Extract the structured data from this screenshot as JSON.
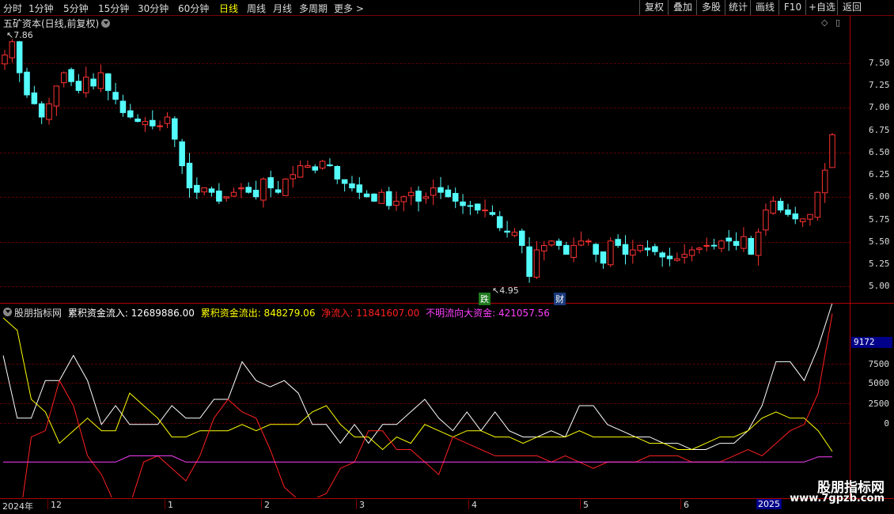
{
  "toolbar": {
    "periods": [
      "分时",
      "1分钟",
      "5分钟",
      "15分钟",
      "30分钟",
      "60分钟",
      "日线",
      "周线",
      "月线",
      "多周期",
      "更多 >"
    ],
    "active_period": "日线",
    "right_buttons": [
      "复权",
      "叠加",
      "多股",
      "统计",
      "画线",
      "F10",
      "+自选",
      "返回"
    ]
  },
  "chart_header": {
    "title": "五矿资本(日线,前复权)"
  },
  "price_axis": {
    "labels": [
      "7.50",
      "7.25",
      "7.00",
      "6.75",
      "6.50",
      "6.25",
      "6.00",
      "5.75",
      "5.50",
      "5.25",
      "5.00"
    ]
  },
  "price_annotations": {
    "high": "7.86",
    "low": "4.95",
    "tag_die": "跌",
    "tag_cai": "财"
  },
  "indicator": {
    "name": "股朋指标网",
    "items": [
      {
        "label": "累积资金流入: 12689886.00",
        "color": "#ffffff"
      },
      {
        "label": "累积资金流出: 848279.06",
        "color": "#ffff00"
      },
      {
        "label": "净流入: 11841607.00",
        "color": "#ff2020"
      },
      {
        "label": "不明流向大资金: 421057.56",
        "color": "#ff40ff"
      }
    ],
    "axis_labels": [
      "7500",
      "5000",
      "2500",
      "0"
    ],
    "current_value": "9172"
  },
  "time_axis": {
    "labels": [
      "2024年",
      "12",
      "1",
      "2",
      "3",
      "4",
      "5",
      "6",
      "2025"
    ]
  },
  "watermark": {
    "line1": "股朋指标网",
    "line2": "www.7gpzb.com"
  },
  "colors": {
    "up": "#ff3232",
    "down": "#54fcfc",
    "grid": "#5a0000",
    "frame": "#b00000",
    "active": "#ffff00"
  },
  "chart_data": [
    {
      "type": "candlestick",
      "title": "五矿资本(日线,前复权)",
      "ylim": [
        4.9,
        7.9
      ],
      "close_series": [
        7.6,
        7.75,
        7.4,
        7.15,
        7.05,
        6.9,
        7.05,
        7.25,
        7.4,
        7.3,
        7.2,
        7.35,
        7.25,
        7.4,
        7.2,
        7.1,
        6.95,
        6.9,
        6.85,
        6.85,
        6.8,
        6.8,
        6.9,
        6.65,
        6.35,
        6.1,
        6.05,
        6.1,
        6.05,
        5.95,
        6.0,
        6.05,
        6.1,
        6.05,
        6.0,
        6.2,
        6.1,
        6.05,
        6.2,
        6.25,
        6.35,
        6.35,
        6.3,
        6.4,
        6.35,
        6.2,
        6.15,
        6.1,
        6.05,
        6.0,
        5.95,
        6.05,
        5.9,
        5.95,
        6.0,
        6.05,
        5.95,
        6.0,
        6.1,
        6.05,
        6.0,
        5.95,
        5.9,
        5.9,
        5.85,
        5.85,
        5.8,
        5.65,
        5.6,
        5.6,
        5.45,
        5.1,
        5.4,
        5.45,
        5.5,
        5.45,
        5.35,
        5.45,
        5.5,
        5.5,
        5.35,
        5.25,
        5.5,
        5.45,
        5.35,
        5.4,
        5.45,
        5.4,
        5.38,
        5.32,
        5.3,
        5.3,
        5.35,
        5.4,
        5.42,
        5.45,
        5.45,
        5.5,
        5.5,
        5.45,
        5.55,
        5.35,
        5.6,
        5.85,
        5.95,
        5.85,
        5.8,
        5.75,
        5.75,
        5.8,
        6.05,
        6.3,
        6.7
      ],
      "high": 7.86,
      "low": 4.95,
      "tags": [
        "跌",
        "财"
      ]
    },
    {
      "type": "line",
      "title": "股朋指标网",
      "ylim": [
        -2500,
        12000
      ],
      "series": [
        {
          "name": "累积资金流入",
          "values": [
            8500,
            3500,
            3500,
            6500,
            6500,
            8500,
            6500,
            3000,
            4500,
            3000,
            3000,
            3000,
            4500,
            3500,
            3500,
            5000,
            5000,
            8000,
            6500,
            6000,
            6500,
            5500,
            3000,
            3000,
            1500,
            3000,
            1500,
            3000,
            3000,
            4000,
            5000,
            3500,
            2500,
            4000,
            2500,
            4000,
            2500,
            2000,
            2000,
            2500,
            2000,
            4500,
            4500,
            3000,
            2500,
            2000,
            2000,
            1500,
            1500,
            1000,
            1000,
            1500,
            1500,
            2500,
            4500,
            8000,
            8000,
            6500,
            9172,
            12689
          ]
        },
        {
          "name": "累积资金流出",
          "values": [
            11500,
            10500,
            5000,
            4000,
            1500,
            2500,
            3500,
            2500,
            2500,
            5500,
            4500,
            3500,
            2000,
            2000,
            2500,
            2500,
            2500,
            3000,
            2500,
            3000,
            3000,
            3000,
            4000,
            4500,
            3000,
            2000,
            2000,
            1000,
            2000,
            1500,
            3000,
            2500,
            2000,
            2500,
            2500,
            2000,
            2000,
            1500,
            2000,
            2000,
            2000,
            2500,
            2000,
            2000,
            2000,
            2000,
            1500,
            1500,
            1000,
            1000,
            1500,
            2000,
            2000,
            2500,
            3500,
            4000,
            3500,
            3500,
            2500,
            850
          ]
        },
        {
          "name": "净流入",
          "values": [
            -3000,
            -6000,
            2000,
            2500,
            6500,
            4500,
            500,
            -1000,
            -3500,
            -3500,
            0,
            500,
            -500,
            -1500,
            500,
            3500,
            5000,
            4000,
            3500,
            1000,
            -2000,
            -3000,
            -3000,
            -2500,
            -500,
            0,
            2500,
            2500,
            1000,
            1000,
            0,
            -1000,
            2000,
            1500,
            1000,
            500,
            500,
            500,
            500,
            0,
            500,
            0,
            -500,
            0,
            0,
            0,
            500,
            500,
            500,
            0,
            0,
            0,
            500,
            1000,
            500,
            1500,
            2500,
            3000,
            5500,
            11841
          ]
        },
        {
          "name": "不明流向大资金",
          "values": [
            0,
            0,
            0,
            0,
            0,
            0,
            0,
            0,
            0,
            500,
            500,
            500,
            500,
            0,
            0,
            0,
            0,
            0,
            0,
            0,
            0,
            0,
            0,
            0,
            0,
            0,
            0,
            0,
            0,
            0,
            0,
            0,
            0,
            0,
            0,
            0,
            0,
            0,
            0,
            0,
            0,
            0,
            0,
            0,
            0,
            0,
            0,
            0,
            0,
            0,
            0,
            0,
            0,
            0,
            0,
            0,
            0,
            0,
            421,
            421
          ]
        }
      ],
      "x": [
        "2024年",
        "12",
        "1",
        "2",
        "3",
        "4",
        "5",
        "6",
        "2025"
      ]
    }
  ]
}
